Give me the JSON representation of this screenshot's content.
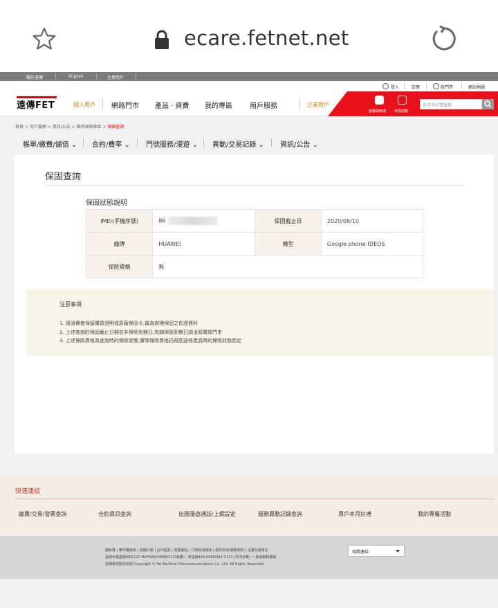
{
  "browser": {
    "url": "ecare.fetnet.net"
  },
  "top_strip": {
    "items": [
      "關於遠傳",
      "English",
      "企業用戶"
    ]
  },
  "util_bar": {
    "login": "登入",
    "register": "註冊",
    "store": "我門市",
    "sitemap": "網站地圖"
  },
  "main_nav": {
    "logo_text": "遠傳FET",
    "items": [
      "個人用戶",
      "網路門市",
      "產品 · 資費",
      "我的專區",
      "用戶服務",
      "企業用戶"
    ],
    "red_icons": [
      "客服即時通",
      "常見問題"
    ],
    "search_placeholder": "月月有好禮優惠"
  },
  "breadcrumb": {
    "items": [
      "首頁",
      "用戶服務",
      "資訊/公告",
      "維修保固專區"
    ],
    "current": "保固查詢"
  },
  "sub_nav": {
    "items": [
      "帳單/繳費/儲值",
      "合約/費率",
      "門號服務/漫遊",
      "異動/交易記錄",
      "資訊/公告"
    ]
  },
  "page": {
    "title": "保固查詢",
    "section_title": "保固狀態說明",
    "table": {
      "imei_label": "IMEI(手機序號)",
      "imei_value": "86",
      "warranty_end_label": "保固截止日",
      "warranty_end_value": "2020/06/10",
      "brand_label": "廠牌",
      "brand_value": "HUAWEI",
      "model_label": "機型",
      "model_value": "Google phone-IDEOS",
      "insurance_label": "保險資格",
      "insurance_value": "無"
    }
  },
  "notes": {
    "title": "注意事項",
    "items": [
      "1. 請消費者保留購買證明或原廠保固卡,做為辦理保固之佐證資料",
      "2. 上述查詢的保固截止日期並非保險到期日,有關保險到期日請洽原購買門市",
      "3. 上述保險資格為查詢時的保險狀態,實際保險資格仍視您送修產品時的保險狀態而定"
    ]
  },
  "quick_links": {
    "title": "快速連結",
    "items": [
      "繳費/交易/發票查詢",
      "合約資訊查詢",
      "出國漫遊通話/上網設定",
      "服務異動記錄查詢",
      "用戶本月好禮",
      "我的專屬活動"
    ]
  },
  "footer": {
    "links": "隱私權 | 著作權條款 | 視播行銷 | 合作提案 | 營業據點 | 行政院消保會 | 發票商家/服務契約 | 企業社會責任",
    "line2": "遠傳手機直撥888/123 MVPN用戶9888/123(免費) ; 市話撥449-5888/449-5123 (市內計費) ~ 其他服務專線",
    "line3": "遠傳電信股份有限 Copyright © Far EasTone Telecommunications Co., Ltd. All Rights Reserved.",
    "select_value": "相關連結"
  }
}
